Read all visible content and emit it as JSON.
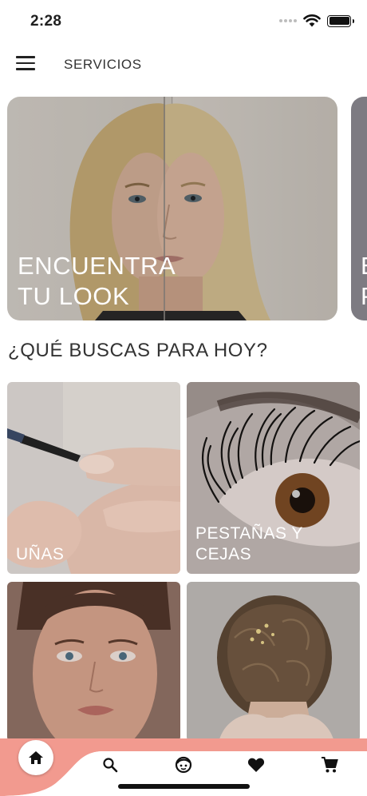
{
  "status_bar": {
    "time": "2:28"
  },
  "app_bar": {
    "title": "SERVICIOS"
  },
  "hero": {
    "slides": [
      {
        "label_line1": "ENCUENTRA",
        "label_line2": "TU LOOK"
      },
      {
        "label_line1": "E",
        "label_line2": "P"
      }
    ]
  },
  "section": {
    "title": "¿QUÉ BUSCAS PARA HOY?"
  },
  "categories": [
    {
      "label_line1": "UÑAS",
      "label_line2": ""
    },
    {
      "label_line1": "PESTAÑAS Y",
      "label_line2": "CEJAS"
    },
    {
      "label_line1": "",
      "label_line2": ""
    },
    {
      "label_line1": "",
      "label_line2": ""
    }
  ],
  "bottom_nav": {
    "items": [
      "home-icon",
      "search-icon",
      "face-icon",
      "heart-icon",
      "cart-icon"
    ],
    "active": "home-icon",
    "accent_color": "#f29a8f"
  }
}
